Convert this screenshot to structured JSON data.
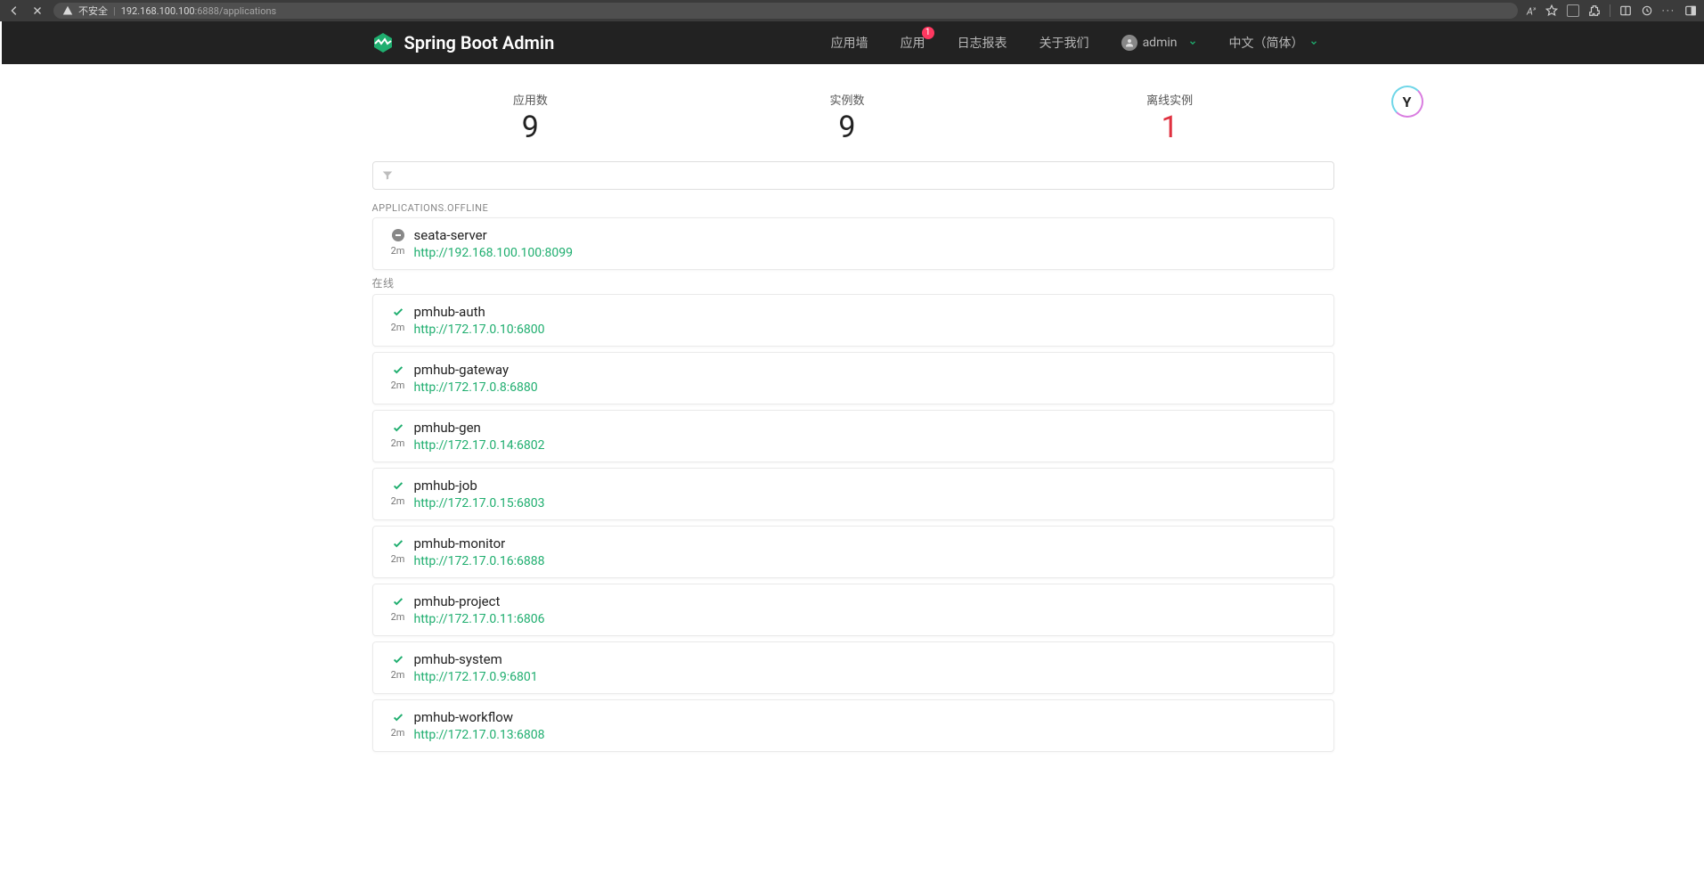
{
  "browser": {
    "warning": "不安全",
    "url_host": "192.168.100.100",
    "url_path": ":6888/applications"
  },
  "navbar": {
    "brand": "Spring Boot Admin",
    "items": {
      "wallboard": "应用墙",
      "applications": "应用",
      "journal": "日志报表",
      "about": "关于我们"
    },
    "badge": "1",
    "user": "admin",
    "language": "中文（简体）"
  },
  "stats": {
    "apps_label": "应用数",
    "apps_value": "9",
    "instances_label": "实例数",
    "instances_value": "9",
    "offline_label": "离线实例",
    "offline_value": "1"
  },
  "sections": {
    "offline_label": "APPLICATIONS.OFFLINE",
    "online_label": "在线"
  },
  "offline": [
    {
      "name": "seata-server",
      "url": "http://192.168.100.100:8099",
      "uptime": "2m"
    }
  ],
  "online": [
    {
      "name": "pmhub-auth",
      "url": "http://172.17.0.10:6800",
      "uptime": "2m"
    },
    {
      "name": "pmhub-gateway",
      "url": "http://172.17.0.8:6880",
      "uptime": "2m"
    },
    {
      "name": "pmhub-gen",
      "url": "http://172.17.0.14:6802",
      "uptime": "2m"
    },
    {
      "name": "pmhub-job",
      "url": "http://172.17.0.15:6803",
      "uptime": "2m"
    },
    {
      "name": "pmhub-monitor",
      "url": "http://172.17.0.16:6888",
      "uptime": "2m"
    },
    {
      "name": "pmhub-project",
      "url": "http://172.17.0.11:6806",
      "uptime": "2m"
    },
    {
      "name": "pmhub-system",
      "url": "http://172.17.0.9:6801",
      "uptime": "2m"
    },
    {
      "name": "pmhub-workflow",
      "url": "http://172.17.0.13:6808",
      "uptime": "2m"
    }
  ]
}
